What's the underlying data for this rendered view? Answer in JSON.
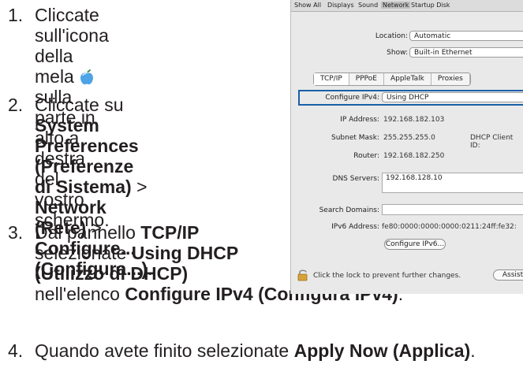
{
  "instructions": {
    "step1": {
      "num": "1.",
      "line1": "Cliccate sull'icona della",
      "line2a": "mela ",
      "line2b": " sulla parte in alto a",
      "line3": "destra del vostro schermo."
    },
    "step2": {
      "num": "2.",
      "line1a": "Cliccate su ",
      "line1b": "System",
      "line2": "Preferences (Preferenze",
      "line3": "di Sistema)",
      "line3b": " > ",
      "line3c": "Network",
      "line4a": "(Rete)",
      "line4b": " > ",
      "line4c": "Configure...",
      "line5": "(Configura...)",
      "line5b": "."
    },
    "step3": {
      "num": "3.",
      "line1a": "Dal pannello ",
      "line1b": "TCP/IP",
      "line2a": "selezionate ",
      "line2b": "Using DHCP",
      "line3": "(Utilizzo di DHCP)",
      "line4a": "nell'elenco ",
      "line4b": "Configure IPv4 (Configura IPv4)",
      "line4c": "."
    },
    "step4": {
      "num": "4.",
      "line1a": "Quando avete finito selezionate ",
      "line1b": "Apply Now (Applica)",
      "line1c": "."
    }
  },
  "window": {
    "toolbar": [
      "Show All",
      "Displays",
      "Sound",
      "Network",
      "Startup Disk"
    ],
    "location_label": "Location:",
    "location_value": "Automatic",
    "show_label": "Show:",
    "show_value": "Built-in Ethernet",
    "tabs": [
      "TCP/IP",
      "PPPoE",
      "AppleTalk",
      "Proxies"
    ],
    "configure_label": "Configure IPv4:",
    "configure_value": "Using DHCP",
    "ip_label": "IP Address:",
    "ip_value": "192.168.182.103",
    "subnet_label": "Subnet Mask:",
    "subnet_value": "255.255.255.0",
    "dhcp_client": "DHCP Client ID:",
    "router_label": "Router:",
    "router_value": "192.168.182.250",
    "dns_label": "DNS Servers:",
    "dns_value": "192.168.128.10",
    "search_label": "Search Domains:",
    "search_value": "",
    "ipv6_label": "IPv6 Address:",
    "ipv6_value": "fe80:0000:0000:0000:0211:24ff:fe32:",
    "configure_ipv6": "Configure IPv6...",
    "lock_text": "Click the lock to prevent further changes.",
    "assist": "Assist"
  }
}
